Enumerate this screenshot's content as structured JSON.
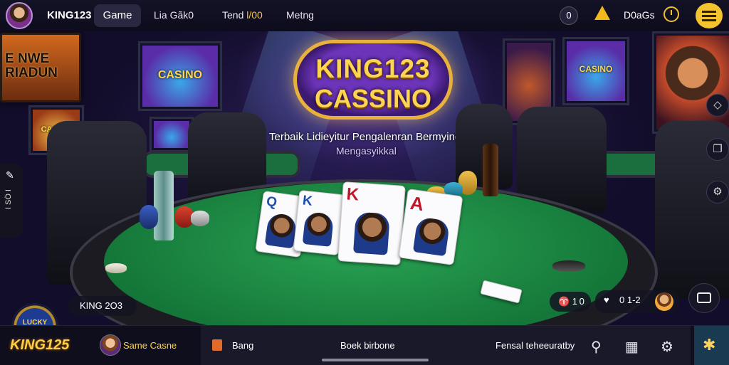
{
  "topbar": {
    "brand": "KING123",
    "tab_game": "Game",
    "link_1": "Lia Gãk0",
    "link_2_prefix": "Tend ",
    "link_2_highlight": "l/00",
    "link_3": "Metng",
    "badge_count": "0",
    "user_label": "D0aGs"
  },
  "hero": {
    "logo_line1": "KING123",
    "logo_line2": "CASSINO",
    "subtitle_line1": "Terbaik Lidieyitur Pengalenran Bermying",
    "subtitle_line2": "Mengasyikkal"
  },
  "background": {
    "poster_left": "E NWE RIADUN",
    "screen_left": "CASINO",
    "screen_small": "CASINO",
    "screen_right": "CASINO"
  },
  "cards": [
    {
      "rank": "Q",
      "suit_color": "blue"
    },
    {
      "rank": "K",
      "suit_color": "blue"
    },
    {
      "rank": "K",
      "suit_color": "red"
    },
    {
      "rank": "A",
      "suit_color": "red"
    }
  ],
  "left_rail": {
    "vertical_text": "I SÖ I"
  },
  "status": {
    "badge_logo_text": "LUCKY RAINBOW",
    "table_label": "KING 2O3",
    "seat_count": "♈ 1 0",
    "score_text": "0  1-2"
  },
  "bottombar": {
    "logo": "KING125",
    "player_name": "Same Casne",
    "menu_1": "Bang",
    "menu_2": "Boek birbone",
    "menu_3": "Fensal teheeuratby"
  }
}
